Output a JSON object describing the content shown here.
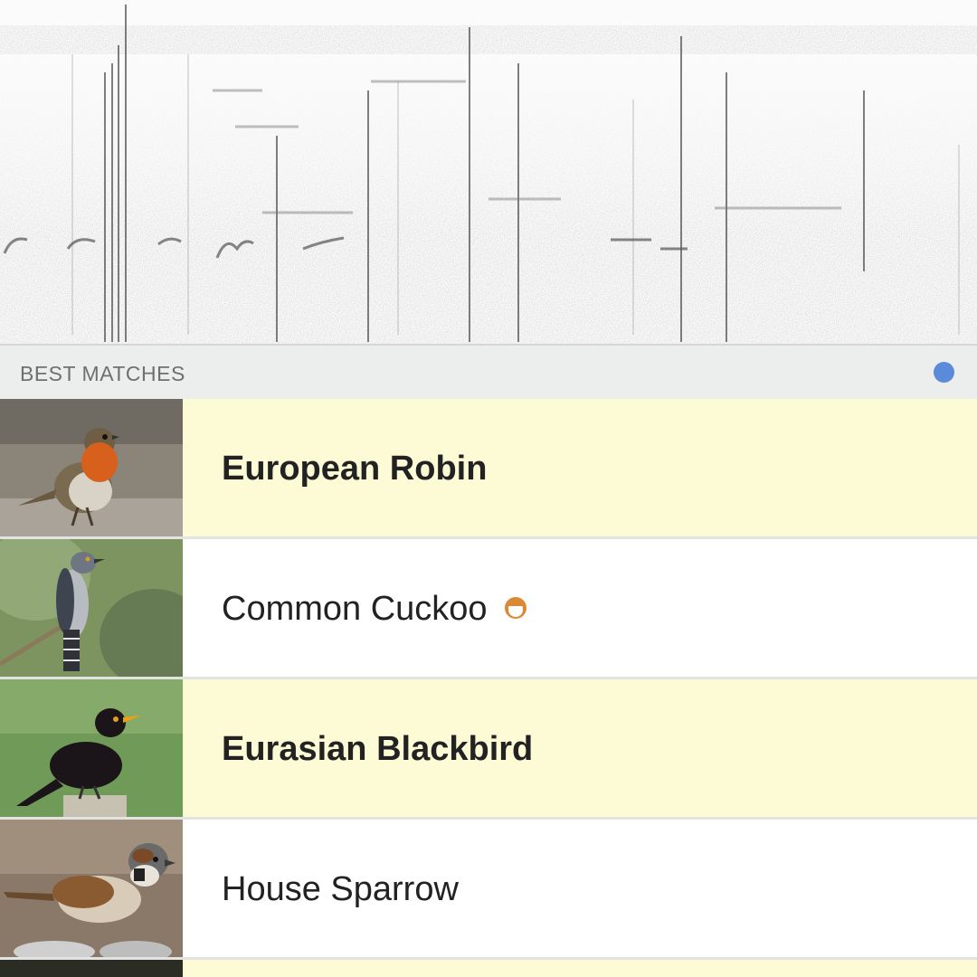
{
  "section": {
    "title": "BEST MATCHES",
    "status_color": "#5b8ad8"
  },
  "results": [
    {
      "name": "European Robin",
      "highlighted": true,
      "thumbnail": "european-robin-photo"
    },
    {
      "name": "Common Cuckoo",
      "highlighted": false,
      "thumbnail": "common-cuckoo-photo",
      "badge_icon": "half-circle-badge-icon",
      "badge_color": "#d88a37"
    },
    {
      "name": "Eurasian Blackbird",
      "highlighted": true,
      "thumbnail": "eurasian-blackbird-photo"
    },
    {
      "name": "House Sparrow",
      "highlighted": false,
      "thumbnail": "house-sparrow-photo"
    }
  ],
  "colors": {
    "highlight_row": "#fdfbd6",
    "header_bg": "#eceeed"
  }
}
